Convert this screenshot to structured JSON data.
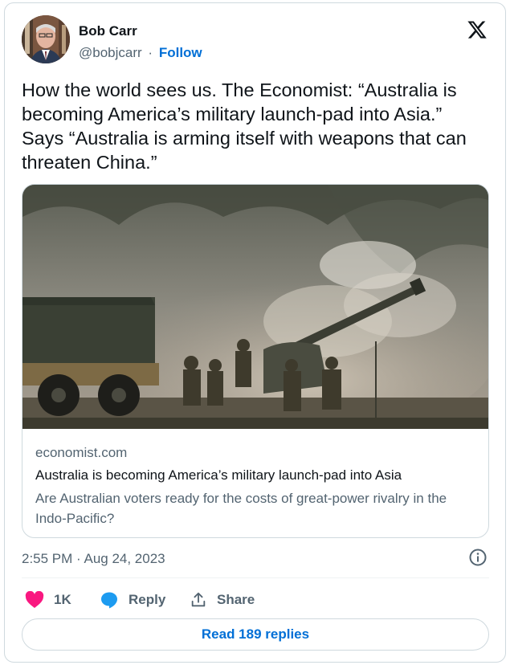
{
  "author": {
    "name": "Bob Carr",
    "handle": "@bobjcarr",
    "separator": "·",
    "follow_label": "Follow"
  },
  "tweet": {
    "text": "How the world sees us. The Economist: “Australia is becoming America’s military launch-pad into Asia.” Says “Australia is arming itself with weapons that can threaten China.”",
    "timestamp": "2:55 PM · Aug 24, 2023"
  },
  "link_card": {
    "domain": "economist.com",
    "title": "Australia is becoming America’s military launch-pad into Asia",
    "description": "Are Australian voters ready for the costs of great-power rivalry in the Indo-Pacific?"
  },
  "actions": {
    "like_count": "1K",
    "reply_label": "Reply",
    "share_label": "Share",
    "read_replies_label": "Read 189 replies"
  },
  "colors": {
    "link_blue": "#006fd6",
    "like_pink": "#f91880",
    "reply_blue": "#1d9bf0",
    "muted_gray": "#536471"
  },
  "icons": [
    "x-logo-icon",
    "info-icon",
    "heart-icon",
    "reply-bubble-icon",
    "share-icon"
  ]
}
